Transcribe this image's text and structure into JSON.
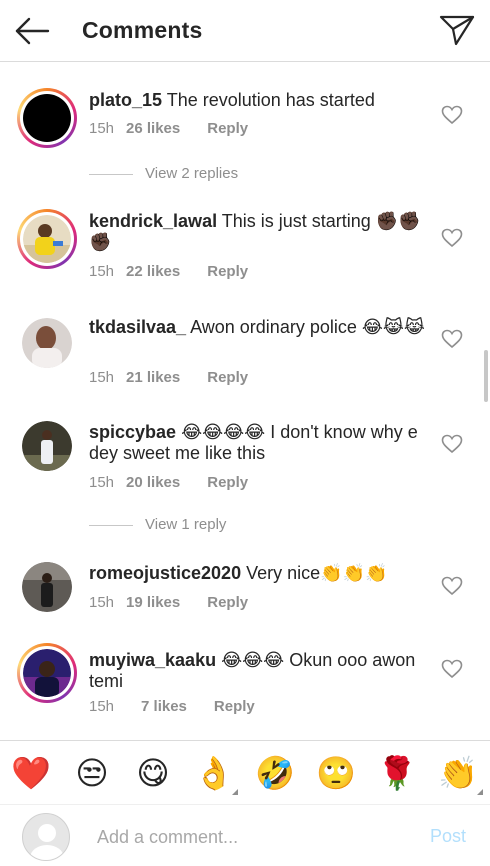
{
  "header": {
    "title": "Comments",
    "back_icon": "arrow-left-icon",
    "share_icon": "paper-plane-icon"
  },
  "comments": [
    {
      "username": "plato_15",
      "text": "The revolution has started",
      "time": "15h",
      "likes": "26 likes",
      "reply": "Reply",
      "story_ring": true
    },
    {
      "username": "kendrick_lawal",
      "text": "This is just starting ✊🏿✊🏿✊🏿",
      "time": "15h",
      "likes": "22 likes",
      "reply": "Reply",
      "story_ring": true
    },
    {
      "username": "tkdasilvaa_",
      "text": "Awon ordinary police 😂😹😹",
      "time": "15h",
      "likes": "21 likes",
      "reply": "Reply",
      "story_ring": false
    },
    {
      "username": "spiccybae",
      "text": "😂😂😂😂 I don't know why e dey sweet me like this",
      "time": "15h",
      "likes": "20 likes",
      "reply": "Reply",
      "story_ring": false
    },
    {
      "username": "romeojustice2020",
      "text": "Very nice👏👏👏",
      "time": "15h",
      "likes": "19 likes",
      "reply": "Reply",
      "story_ring": false
    },
    {
      "username": "muyiwa_kaaku",
      "text": "😂😂😂 Okun ooo awon temi",
      "time": "15h",
      "likes": "7 likes",
      "reply": "Reply",
      "story_ring": true
    }
  ],
  "view_replies": [
    {
      "label": "View 2 replies"
    },
    {
      "label": "View 1 reply"
    }
  ],
  "quick_emojis": [
    "❤️",
    "😒",
    "😋",
    "👌",
    "🤣",
    "🙄",
    "🌹",
    "👏"
  ],
  "composer": {
    "placeholder": "Add a comment...",
    "post_label": "Post"
  },
  "colors": {
    "link_blue_disabled": "#b2dffc",
    "secondary_text": "#8e8e8e",
    "primary_text": "#262626"
  }
}
